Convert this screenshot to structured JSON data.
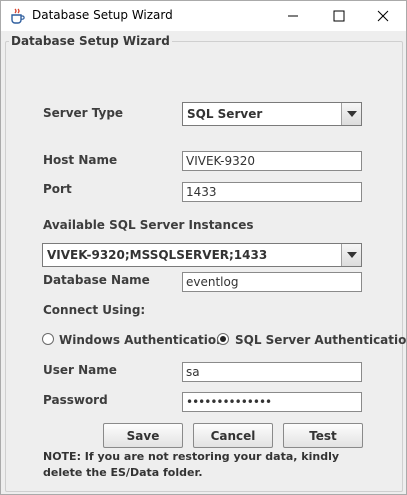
{
  "window": {
    "title": "Database Setup Wizard",
    "controls": {
      "minimize": "minimize-icon",
      "maximize": "maximize-icon",
      "close": "close-icon"
    }
  },
  "group": {
    "title": "Database Setup Wizard"
  },
  "form": {
    "server_type": {
      "label": "Server Type",
      "value": "SQL Server"
    },
    "host_name": {
      "label": "Host Name",
      "value": "VIVEK-9320"
    },
    "port": {
      "label": "Port",
      "value": "1433"
    },
    "instances": {
      "label": "Available SQL Server Instances",
      "value": "VIVEK-9320;MSSQLSERVER;1433"
    },
    "database_name": {
      "label": "Database Name",
      "value": "eventlog"
    },
    "connect_using": {
      "label": "Connect Using:",
      "options": [
        "Windows Authentication",
        "SQL Server Authentication"
      ],
      "selected": "SQL Server Authentication"
    },
    "user_name": {
      "label": "User Name",
      "value": "sa"
    },
    "password": {
      "label": "Password",
      "value": "••••••••••••••"
    }
  },
  "buttons": {
    "save": "Save",
    "cancel": "Cancel",
    "test": "Test"
  },
  "note": "NOTE: If you are not restoring your data, kindly delete the ES/Data folder."
}
